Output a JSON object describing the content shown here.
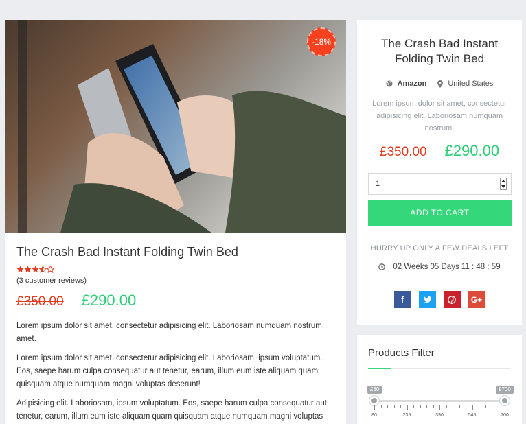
{
  "product": {
    "discount_badge": "-18%",
    "title": "The Crash Bad Instant Folding Twin Bed",
    "rating": 3.5,
    "rating_max": 5,
    "reviews_text": "(3 customer reviews)",
    "old_price": "£350.00",
    "new_price": "£290.00",
    "paragraphs": [
      "Lorem ipsum dolor sit amet, consectetur adipisicing elit. Laboriosam numquam nostrum. amet.",
      "Lorem ipsum dolor sit amet, consectetur adipisicing elit. Laboriosam, ipsum voluptatum. Eos, saepe harum culpa consequatur aut tenetur, earum, illum eum iste aliquam quam quisquam atque numquam magni voluptas deserunt!",
      "Adipisicing elit. Laboriosam, ipsum voluptatum. Eos, saepe harum culpa consequatur aut tenetur, earum, illum eum iste aliquam quam quisquam atque numquam magni voluptas deserunt!"
    ]
  },
  "side": {
    "title": "The Crash Bad Instant Folding Twin Bed",
    "store": "Amazon",
    "location": "United States",
    "description": "Lorem ipsum dolor sit amet, consectetur adipisicing elit. Laboriosam numquam nostrum.",
    "old_price": "£350.00",
    "new_price": "£290.00",
    "quantity": "1",
    "add_to_cart": "ADD TO CART",
    "hurry_text": "HURRY UP ONLY A FEW DEALS LEFT",
    "countdown": "02 Weeks 05 Days 11 : 48 : 59",
    "social": [
      {
        "icon": "facebook-icon",
        "glyph": "f",
        "color": "#3b5a9a"
      },
      {
        "icon": "twitter-icon",
        "glyph": "t",
        "color": "#1da1f2"
      },
      {
        "icon": "pinterest-icon",
        "glyph": "p",
        "color": "#c8232c"
      },
      {
        "icon": "google-plus-icon",
        "glyph": "G+",
        "color": "#dd4b39"
      }
    ]
  },
  "filter": {
    "title": "Products Filter",
    "min_value": "£80",
    "max_value": "£700",
    "tick_labels": [
      "80",
      "235",
      "390",
      "545",
      "700"
    ]
  },
  "colors": {
    "accent_green": "#34d77a",
    "sale_red": "#e03a1f",
    "badge_orange": "#f5411f"
  }
}
